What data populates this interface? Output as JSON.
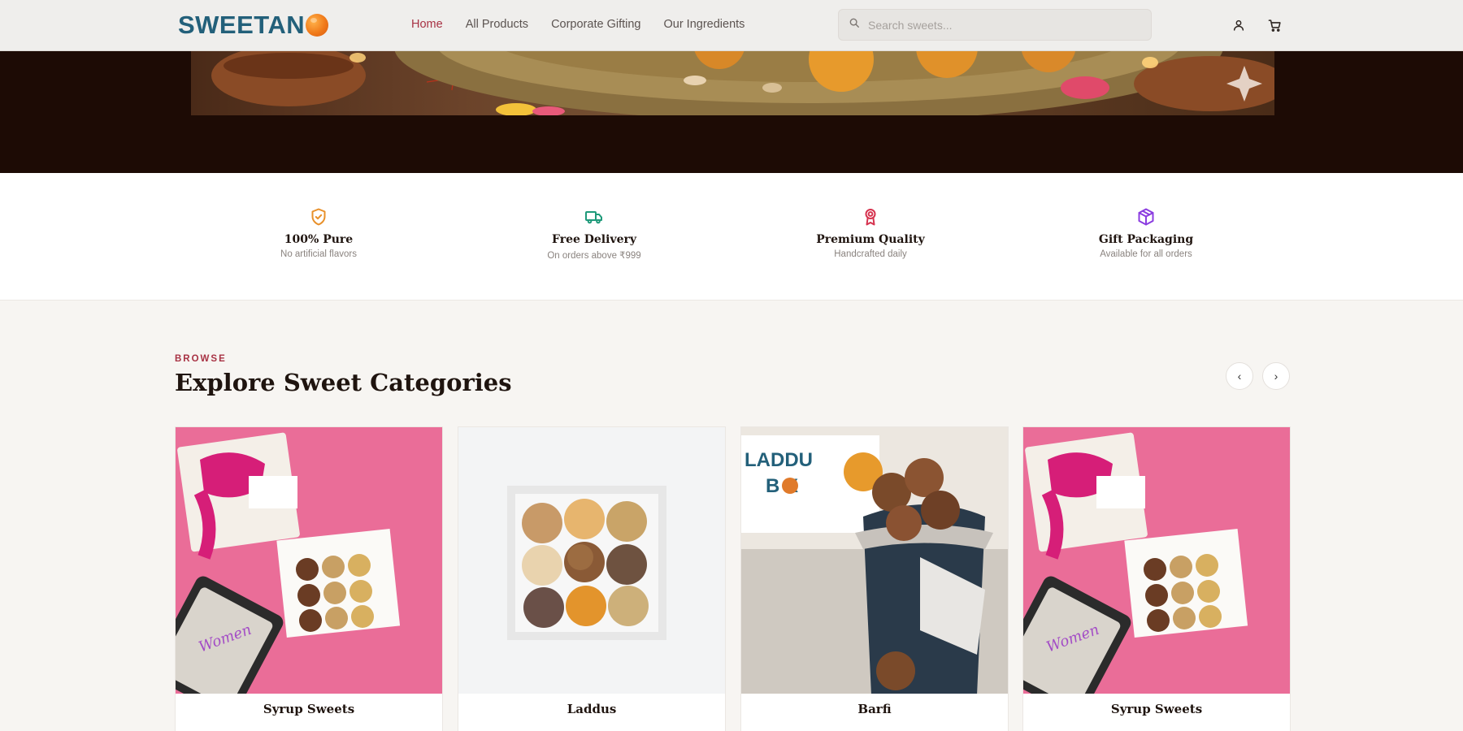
{
  "header": {
    "logo_text": "SWEETAN",
    "nav": [
      {
        "label": "Home",
        "active": true
      },
      {
        "label": "All Products",
        "active": false
      },
      {
        "label": "Corporate Gifting",
        "active": false
      },
      {
        "label": "Our Ingredients",
        "active": false
      }
    ],
    "search_placeholder": "Search sweets...",
    "icons": [
      "user-icon",
      "cart-icon"
    ]
  },
  "features": [
    {
      "icon": "shield-check-icon",
      "title": "100% Pure",
      "subtitle": "No artificial flavors",
      "color": "#e8902a"
    },
    {
      "icon": "truck-icon",
      "title": "Free Delivery",
      "subtitle": "On orders above ₹999",
      "color": "#1f9a7a"
    },
    {
      "icon": "award-icon",
      "title": "Premium Quality",
      "subtitle": "Handcrafted daily",
      "color": "#d6334f"
    },
    {
      "icon": "gift-box-icon",
      "title": "Gift Packaging",
      "subtitle": "Available for all orders",
      "color": "#8b3ce0"
    }
  ],
  "categories_section": {
    "eyebrow": "BROWSE",
    "title": "Explore Sweet Categories",
    "prev_label": "‹",
    "next_label": "›",
    "cards": [
      {
        "label": "Syrup Sweets"
      },
      {
        "label": "Laddus"
      },
      {
        "label": "Barfi"
      },
      {
        "label": "Syrup Sweets"
      }
    ]
  },
  "colors": {
    "brand": "#23607a",
    "accent": "#a83244",
    "hero_bg": "#1d0b05"
  }
}
